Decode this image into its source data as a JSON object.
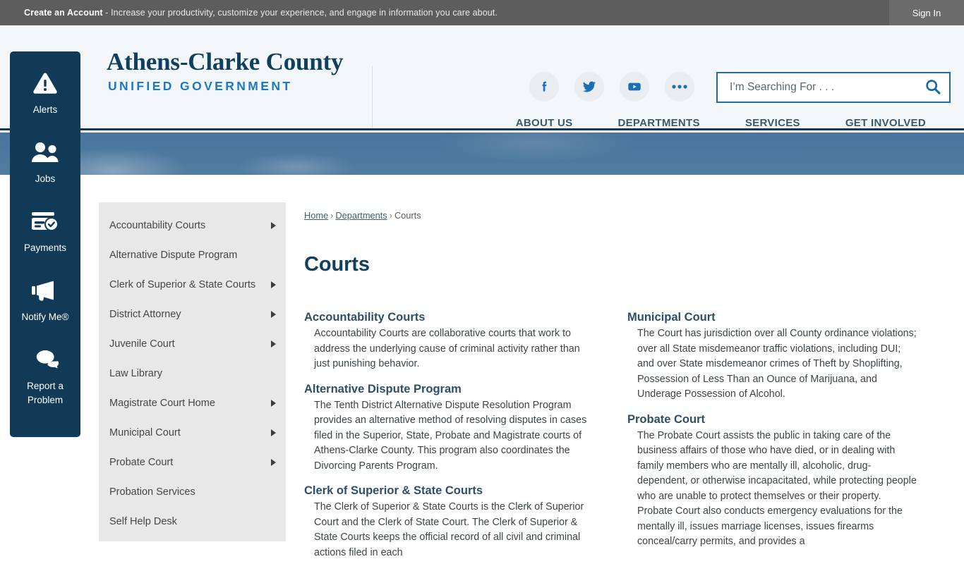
{
  "account_bar": {
    "cta_bold": "Create an Account",
    "cta_rest": " - Increase your productivity, customize your experience, and engage in information you care about.",
    "sign_in": "Sign In"
  },
  "header": {
    "logo_main": "Athens-Clarke County",
    "logo_sub": "UNIFIED GOVERNMENT",
    "social": [
      {
        "name": "facebook-icon",
        "label": "Facebook"
      },
      {
        "name": "twitter-icon",
        "label": "Twitter"
      },
      {
        "name": "youtube-icon",
        "label": "YouTube"
      },
      {
        "name": "more-icon",
        "label": "More"
      }
    ],
    "search": {
      "placeholder": "I’m Searching For . . .",
      "value": "",
      "icon": "search-icon"
    },
    "nav": [
      {
        "label": "ABOUT US"
      },
      {
        "label": "DEPARTMENTS"
      },
      {
        "label": "SERVICES"
      },
      {
        "label": "GET INVOLVED"
      }
    ]
  },
  "rail": {
    "items": [
      {
        "label": "Alerts",
        "icon": "alert-triangle-icon"
      },
      {
        "label": "Jobs",
        "icon": "people-icon"
      },
      {
        "label": "Payments",
        "icon": "payment-card-icon"
      },
      {
        "label": "Notify Me®",
        "icon": "megaphone-icon"
      },
      {
        "label": "Report a Problem",
        "icon": "chat-bubbles-icon"
      }
    ]
  },
  "side_menu": {
    "items": [
      {
        "label": "Accountability Courts",
        "has_submenu": true
      },
      {
        "label": "Alternative Dispute Program",
        "has_submenu": false
      },
      {
        "label": "Clerk of Superior & State Courts",
        "has_submenu": true
      },
      {
        "label": "District Attorney",
        "has_submenu": true
      },
      {
        "label": "Juvenile Court",
        "has_submenu": true
      },
      {
        "label": "Law Library",
        "has_submenu": false
      },
      {
        "label": "Magistrate Court Home",
        "has_submenu": true
      },
      {
        "label": "Municipal Court",
        "has_submenu": true
      },
      {
        "label": "Probate Court",
        "has_submenu": true
      },
      {
        "label": "Probation Services",
        "has_submenu": false
      },
      {
        "label": "Self Help Desk",
        "has_submenu": false
      }
    ]
  },
  "breadcrumb": {
    "home": "Home",
    "departments": "Departments",
    "current": "Courts",
    "separator": "›"
  },
  "page": {
    "title": "Courts"
  },
  "sections_left": [
    {
      "heading": "Accountability Courts",
      "body": "Accountability Courts are collaborative courts that work to address the underlying cause of criminal activity rather than just punishing behavior."
    },
    {
      "heading": "Alternative Dispute Program",
      "body": "The Tenth District Alternative Dispute Resolution Program provides an alternative method of resolving disputes in cases filed in the Superior, State, Probate and Magistrate courts of Athens-Clarke County. This program also coordinates the Divorcing Parents Program."
    },
    {
      "heading": "Clerk of Superior & State Courts",
      "body": "The Clerk of Superior & State Courts is the Clerk of Superior Court and the Clerk of State Court. The Clerk of Superior & State Courts keeps the official record of all civil and criminal actions filed in each"
    }
  ],
  "sections_right": [
    {
      "heading": "Municipal Court",
      "body": "The Court has jurisdiction over all County ordinance violations; over all State misdemeanor traffic violations, including DUI; and over State misdemeanor crimes of Theft by Shoplifting, Possession of Less Than an Ounce of Marijuana, and Underage Possession of Alcohol."
    },
    {
      "heading": "Probate Court",
      "body": "The Probate Court assists the public in taking care of the business affairs of those who have died, or in dealing with family members who are mentally ill, alcoholic, drug-dependent, or otherwise incapacitated, while protecting people who are unable to protect themselves or their property. Probate Court also conducts emergency evaluations for the mentally ill, issues marriage licenses, issues firearms conceal/carry permits, and provides a"
    }
  ],
  "colors": {
    "navy": "#113a56",
    "accent_blue": "#1b7ac0",
    "link_blue": "#1b6fa8",
    "topbar_gray": "#5d5d5d",
    "menu_gray": "#e8e8e8",
    "hero_blue": "#4d789f"
  }
}
